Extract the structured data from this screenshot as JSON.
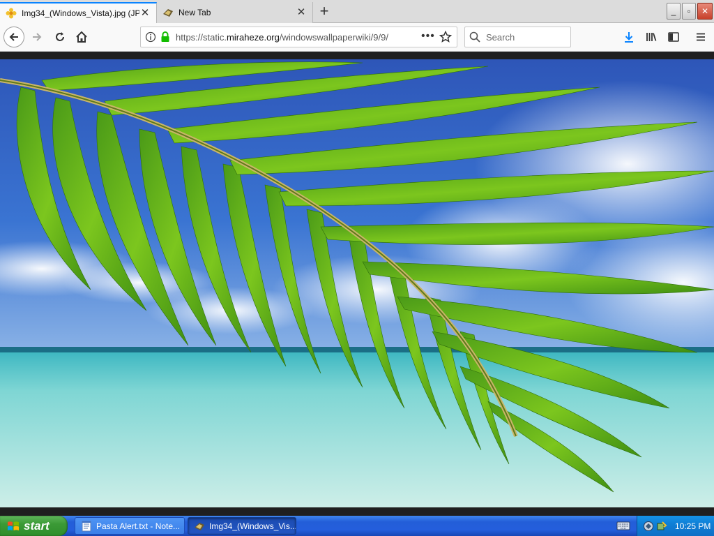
{
  "browser": {
    "tabs": [
      {
        "title": "Img34_(Windows_Vista).jpg (JPEG",
        "active": true
      },
      {
        "title": "New Tab",
        "active": false
      }
    ],
    "url_prefix": "https://static.",
    "url_domain": "miraheze.org",
    "url_path": "/windowswallpaperwiki/9/9/",
    "search_placeholder": "Search"
  },
  "window_controls": {
    "minimize": "_",
    "maximize": "▫",
    "close": "✕"
  },
  "taskbar": {
    "start_label": "start",
    "tasks": [
      {
        "title": "Pasta Alert.txt - Note..."
      },
      {
        "title": "Img34_(Windows_Vis..."
      }
    ],
    "clock": "10:25 PM"
  },
  "colors": {
    "accent": "#0a84ff",
    "lock_green": "#12bc00",
    "download_blue": "#0a84ff",
    "taskbar_blue": "#245edc",
    "start_green": "#3b9a36"
  }
}
